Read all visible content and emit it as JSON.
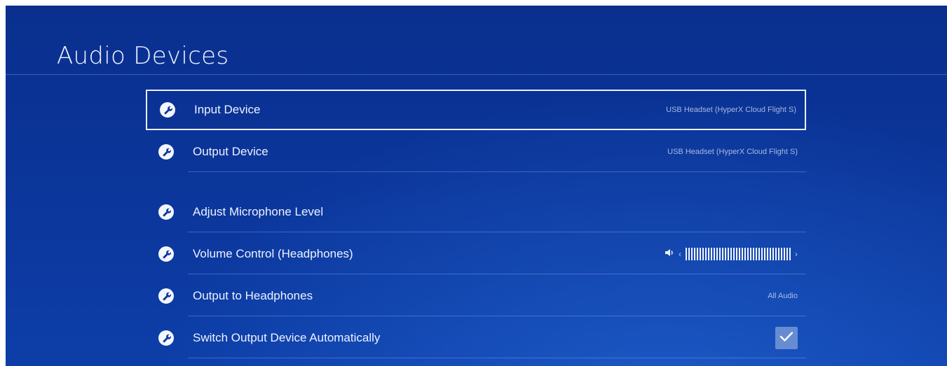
{
  "page": {
    "title": "Audio Devices"
  },
  "settings": [
    {
      "label": "Input Device",
      "value": "USB Headset (HyperX Cloud Flight S)",
      "selected": true
    },
    {
      "label": "Output Device",
      "value": "USB Headset (HyperX Cloud Flight S)"
    },
    {
      "label": "Adjust Microphone Level"
    },
    {
      "label": "Volume Control (Headphones)",
      "volume_level": 1.0
    },
    {
      "label": "Output to Headphones",
      "value": "All Audio"
    },
    {
      "label": "Switch Output Device Automatically",
      "checked": true
    }
  ],
  "icons": {
    "row": "wrench-icon",
    "volume": "speaker-icon",
    "check": "checkmark-icon"
  },
  "colors": {
    "background": "#0b3599",
    "text": "#eef2ff",
    "value_text": "#c8d4f5",
    "focus_border": "#e8eeff"
  }
}
